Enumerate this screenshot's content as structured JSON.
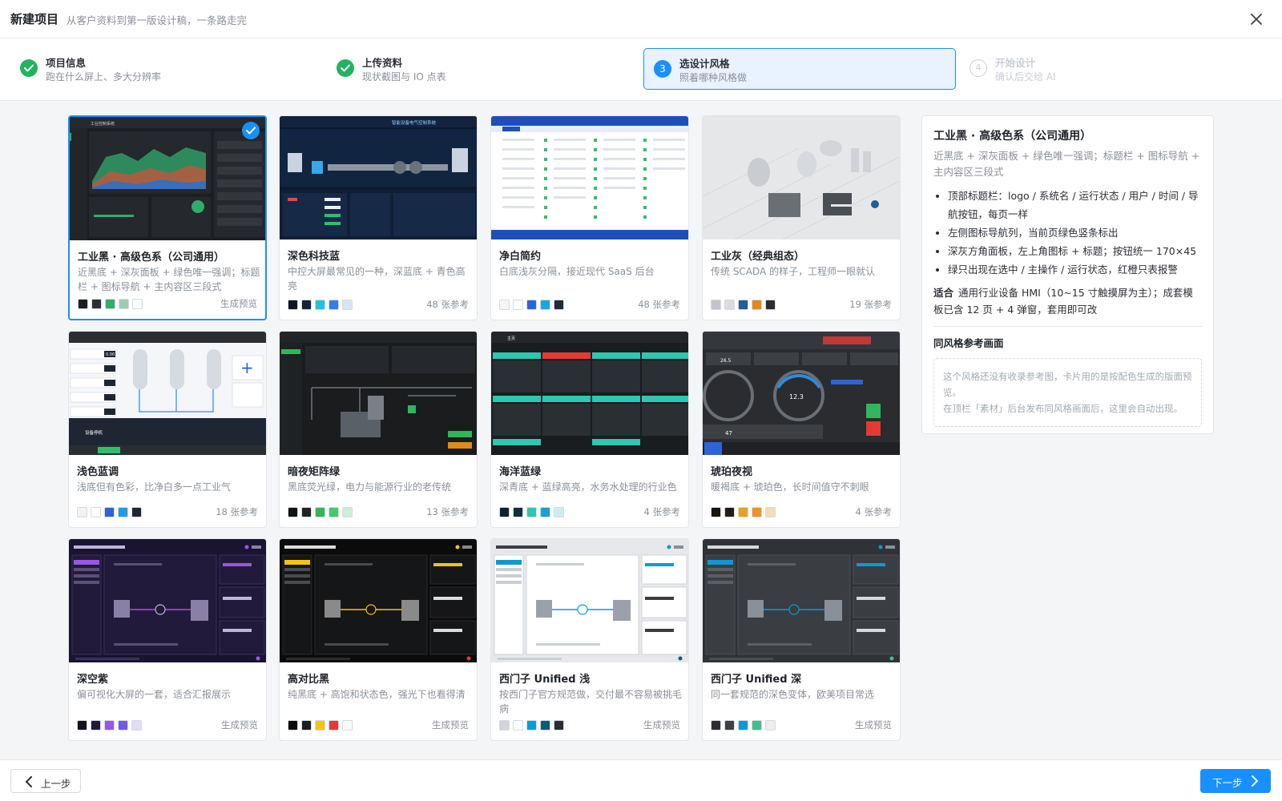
{
  "header": {
    "title": "新建项目",
    "subtitle": "从客户资料到第一版设计稿，一条路走完"
  },
  "steps": [
    {
      "index": "1",
      "title": "项目信息",
      "sub": "跑在什么屏上、多大分辨率",
      "state": "done"
    },
    {
      "index": "2",
      "title": "上传资料",
      "sub": "现状截图与 IO 点表",
      "state": "done"
    },
    {
      "index": "3",
      "title": "选设计风格",
      "sub": "照着哪种风格做",
      "state": "active"
    },
    {
      "index": "4",
      "title": "开始设计",
      "sub": "确认后交给 AI",
      "state": "pending"
    }
  ],
  "cards": [
    {
      "title": "工业黑 · 高级色系（公司通用）",
      "desc": "近黑底 + 深灰面板 + 绿色唯一强调；标题栏 + 图标导航 + 主内容区三段式",
      "meta": "生成预览",
      "swatches": [
        "#1b1d20",
        "#2d3034",
        "#2fae6a",
        "#9fcbb4",
        "#ffffff"
      ],
      "thumb": "dark-green",
      "selected": true
    },
    {
      "title": "深色科技蓝",
      "desc": "中控大屏最常见的一种，深蓝底 + 青色高亮",
      "meta": "48 张参考",
      "swatches": [
        "#0d1526",
        "#16223a",
        "#1fc3e0",
        "#3a7be8",
        "#d6e6f5"
      ],
      "thumb": "tech-blue",
      "selected": false
    },
    {
      "title": "净白简约",
      "desc": "白底浅灰分隔，接近现代 SaaS 后台",
      "meta": "48 张参考",
      "swatches": [
        "#f4f5f7",
        "#ffffff",
        "#2c63d8",
        "#1da6e0",
        "#1f2a3a"
      ],
      "thumb": "white",
      "selected": false
    },
    {
      "title": "工业灰（经典组态）",
      "desc": "传统 SCADA 的样子，工程师一眼就认",
      "meta": "19 张参考",
      "swatches": [
        "#c1c5cb",
        "#d8dbdf",
        "#1f5f9e",
        "#e08a1c",
        "#2a2d31"
      ],
      "thumb": "gray-scada",
      "selected": false
    },
    {
      "title": "浅色蓝调",
      "desc": "浅底但有色彩，比净白多一点工业气",
      "meta": "18 张参考",
      "swatches": [
        "#f1f2f4",
        "#ffffff",
        "#2d64d8",
        "#1d9ee0",
        "#1e2633"
      ],
      "thumb": "light-blue",
      "selected": false
    },
    {
      "title": "暗夜矩阵绿",
      "desc": "黑底荧光绿，电力与能源行业的老传统",
      "meta": "13 张参考",
      "swatches": [
        "#111315",
        "#1d2623",
        "#2fb85a",
        "#43c96a",
        "#cfeed7"
      ],
      "thumb": "matrix-green",
      "selected": false
    },
    {
      "title": "海洋蓝绿",
      "desc": "深青底 + 蓝绿高亮，水务水处理的行业色",
      "meta": "4 张参考",
      "swatches": [
        "#0c2230",
        "#11303d",
        "#2ec7b0",
        "#1d9fd0",
        "#cdeef0"
      ],
      "thumb": "ocean",
      "selected": false
    },
    {
      "title": "琥珀夜视",
      "desc": "暖褐底 + 琥珀色，长时间值守不刺眼",
      "meta": "4 张参考",
      "swatches": [
        "#17130f",
        "#241c14",
        "#e8a020",
        "#f0902a",
        "#f4dcb0"
      ],
      "thumb": "amber",
      "selected": false
    },
    {
      "title": "深空紫",
      "desc": "偏可视化大屏的一套，适合汇报展示",
      "meta": "生成预览",
      "swatches": [
        "#151123",
        "#221a3b",
        "#9b55e6",
        "#6f5ce0",
        "#e2dcf6"
      ],
      "thumb": "purple",
      "selected": false
    },
    {
      "title": "高对比黑",
      "desc": "纯黑底 + 高饱和状态色，强光下也看得清",
      "meta": "生成预览",
      "swatches": [
        "#0b0b0c",
        "#1d1e20",
        "#f2c315",
        "#e53935",
        "#ffffff"
      ],
      "thumb": "contrast",
      "selected": false
    },
    {
      "title": "西门子 Unified 浅",
      "desc": "按西门子官方规范做，交付最不容易被挑毛病",
      "meta": "生成预览",
      "swatches": [
        "#d0d5db",
        "#ffffff",
        "#0b9ad6",
        "#0b5a7a",
        "#2a2d31"
      ],
      "thumb": "siemens-light",
      "selected": false
    },
    {
      "title": "西门子 Unified 深",
      "desc": "同一套规范的深色变体，欧美项目常选",
      "meta": "生成预览",
      "swatches": [
        "#2a2c30",
        "#3c3f44",
        "#0b9ad6",
        "#3fbf8f",
        "#ecedef"
      ],
      "thumb": "siemens-dark",
      "selected": false
    }
  ],
  "detail": {
    "title": "工业黑 · 高级色系（公司通用）",
    "subtitle": "近黑底 + 深灰面板 + 绿色唯一强调；标题栏 + 图标导航 + 主内容区三段式",
    "bullets": [
      "顶部标题栏：logo / 系统名 / 运行状态 / 用户 / 时间 / 导航按钮，每页一样",
      "左侧图标导航列，当前页绿色竖条标出",
      "深灰方角面板，左上角图标 + 标题；按钮统一 170×45",
      "绿只出现在选中 / 主操作 / 运行状态，红橙只表报警"
    ],
    "fit_label": "适合",
    "fit_text": "通用行业设备 HMI（10~15 寸触摸屏为主）；成套模板已含 12 页 + 4 弹窗，套用即可改",
    "ref_title": "同风格参考画面",
    "ref_line1": "这个风格还没有收录参考图，卡片用的是按配色生成的版面预览。",
    "ref_line2": "在顶栏「素材」后台发布同风格画面后，这里会自动出现。"
  },
  "footer": {
    "prev_label": "上一步",
    "next_label": "下一步"
  },
  "thumb_text": {
    "t1": "工业控制系统",
    "t2": "智能设备电气控制系统",
    "t7a": "主页",
    "t8a": "12.3",
    "t8b": "26.5",
    "t8c": "47",
    "t5a": "0.00",
    "t5b": "设备停机"
  }
}
